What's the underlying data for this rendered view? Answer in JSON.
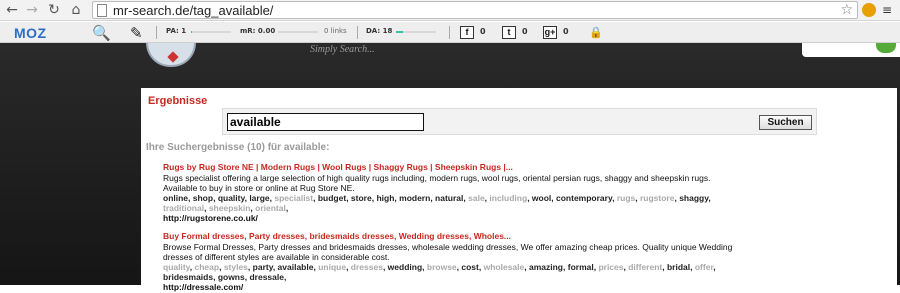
{
  "browser": {
    "url": "mr-search.de/tag_available/",
    "back_icon": "back-arrow-icon",
    "forward_icon": "forward-arrow-icon",
    "reload_icon": "reload-icon",
    "home_icon": "home-icon"
  },
  "mozbar": {
    "logo": "MOZ",
    "pa_label": "PA: 1",
    "pa_value": 0.01,
    "mr_label": "mR: 0.00",
    "links_label": "0 links",
    "da_label": "DA: 18",
    "da_value": 0.18,
    "facebook_count": "0",
    "twitter_count": "0",
    "gplus_count": "0"
  },
  "site": {
    "tagline": "Simply Search...",
    "section_title": "Ergebnisse",
    "search_value": "available",
    "search_button": "Suchen",
    "results_heading": "Ihre Suchergebnisse (10) für available:"
  },
  "results": [
    {
      "title": "Rugs by Rug Store NE | Modern Rugs | Wool Rugs | Shaggy Rugs | Sheepskin Rugs |...",
      "description": "Rugs specialist offering a large selection of high quality rugs including, modern rugs, wool rugs, oriental persian rugs, shaggy and sheepskin rugs. Available to buy in store or online at Rug Store NE.",
      "tags": [
        {
          "text": "online",
          "light": false
        },
        {
          "text": "shop",
          "light": false
        },
        {
          "text": "quality",
          "light": false
        },
        {
          "text": "large",
          "light": false
        },
        {
          "text": "specialist",
          "light": true
        },
        {
          "text": "budget",
          "light": false
        },
        {
          "text": "store",
          "light": false
        },
        {
          "text": "high",
          "light": false
        },
        {
          "text": "modern",
          "light": false
        },
        {
          "text": "natural",
          "light": false
        },
        {
          "text": "sale",
          "light": true
        },
        {
          "text": "including",
          "light": true
        },
        {
          "text": "wool",
          "light": false
        },
        {
          "text": "contemporary",
          "light": false
        },
        {
          "text": "rugs",
          "light": true
        },
        {
          "text": "rugstore",
          "light": true
        },
        {
          "text": "shaggy",
          "light": false
        },
        {
          "text": "traditional",
          "light": true
        },
        {
          "text": "sheepskin",
          "light": true
        },
        {
          "text": "oriental",
          "light": true
        }
      ],
      "url": "http://rugstorene.co.uk/"
    },
    {
      "title": "Buy Formal dresses, Party dresses, bridesmaids dresses, Wedding dresses, Wholes...",
      "description": "Browse Formal Dresses, Party dresses and bridesmaids dresses, wholesale wedding dresses, We offer amazing cheap prices. Quality unique Wedding dresses of different styles are available in considerable cost.",
      "tags": [
        {
          "text": "quality",
          "light": true
        },
        {
          "text": "cheap",
          "light": true
        },
        {
          "text": "styles",
          "light": true
        },
        {
          "text": "party",
          "light": false
        },
        {
          "text": "available",
          "light": false
        },
        {
          "text": "unique",
          "light": true
        },
        {
          "text": "dresses",
          "light": true
        },
        {
          "text": "wedding",
          "light": false
        },
        {
          "text": "browse",
          "light": true
        },
        {
          "text": "cost",
          "light": false
        },
        {
          "text": "wholesale",
          "light": true
        },
        {
          "text": "amazing",
          "light": false
        },
        {
          "text": "formal",
          "light": false
        },
        {
          "text": "prices",
          "light": true
        },
        {
          "text": "different",
          "light": true
        },
        {
          "text": "bridal",
          "light": false
        },
        {
          "text": "offer",
          "light": true
        },
        {
          "text": "bridesmaids",
          "light": false
        },
        {
          "text": "gowns",
          "light": false
        },
        {
          "text": "dressale",
          "light": false
        }
      ],
      "url": "http://dressale.com/"
    }
  ]
}
